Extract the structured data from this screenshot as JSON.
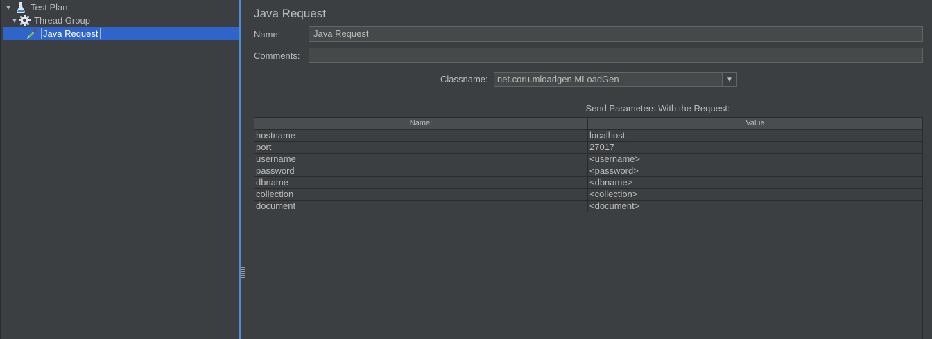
{
  "tree": {
    "items": [
      {
        "label": "Test Plan",
        "icon": "flask-icon"
      },
      {
        "label": "Thread Group",
        "icon": "gear-icon"
      },
      {
        "label": "Java Request",
        "icon": "pipette-icon",
        "selected": true
      }
    ]
  },
  "panel": {
    "title": "Java Request",
    "name_label": "Name:",
    "name_value": "Java Request",
    "comments_label": "Comments:",
    "comments_value": "",
    "classname_label": "Classname:",
    "classname_value": "net.coru.mloadgen.MLoadGen",
    "params_caption": "Send Parameters With the Request:"
  },
  "table": {
    "headers": [
      "Name:",
      "Value"
    ],
    "rows": [
      [
        "hostname",
        "localhost"
      ],
      [
        "port",
        "27017"
      ],
      [
        "username",
        "<username>"
      ],
      [
        "password",
        "<password>"
      ],
      [
        "dbname",
        "<dbname>"
      ],
      [
        "collection",
        "<collection>"
      ],
      [
        "document",
        "<document>"
      ]
    ]
  },
  "colors": {
    "background": "#3c3f41",
    "selection": "#2f65ca",
    "splitter": "#4b8fd6"
  }
}
